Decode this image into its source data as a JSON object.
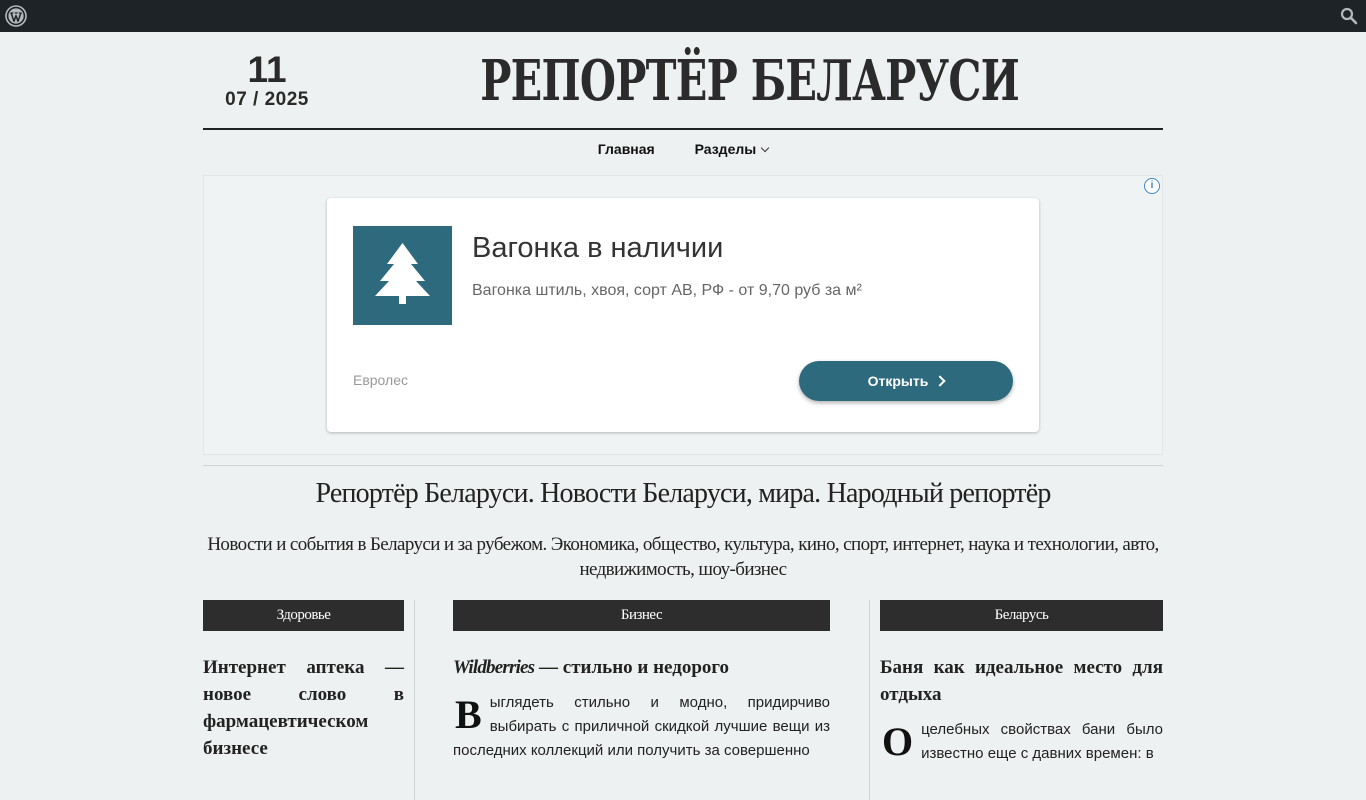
{
  "adminbar": {
    "logo_icon": "wordpress-icon",
    "search_icon": "search-icon"
  },
  "header": {
    "date_day": "11",
    "date_month_year": "07 / 2025",
    "site_title": "РЕПОРТЁР БЕЛАРУСИ"
  },
  "nav": {
    "items": [
      {
        "label": "Главная"
      },
      {
        "label": "Разделы",
        "icon": "chevron-down-icon"
      }
    ]
  },
  "ad": {
    "info_icon": "info-icon",
    "logo_icon": "tree-icon",
    "title": "Вагонка в наличии",
    "description": "Вагонка штиль, хвоя, сорт АВ, РФ - от 9,70 руб за м²",
    "brand": "Евролес",
    "button_label": "Открыть",
    "accent_color": "#2e6a7e"
  },
  "site": {
    "tagline": "Репортёр Беларуси. Новости Беларуси, мира. Народный репортёр",
    "description": "Новости и события в Беларуси и за рубежом. Экономика, общество, культура, кино, спорт, интернет, наука и технологии, авто, недвижимость, шоу-бизнес"
  },
  "columns": [
    {
      "heading": "Здоровье",
      "article_title": "Интернет аптека — новое слово в фармацевтическом бизнесе"
    },
    {
      "heading": "Бизнес",
      "article_title_em": "Wildberries",
      "article_title_rest": " — стильно и недорого",
      "dropcap": "В",
      "excerpt": "ыглядеть стильно и модно, придирчиво выбирать с приличной скидкой лучшие вещи из последних коллекций или получить за совершенно"
    },
    {
      "heading": "Беларусь",
      "article_title": "Баня как идеальное место для отдыха",
      "dropcap": "О",
      "excerpt": "целебных свойствах бани было известно еще с давних времен: в"
    }
  ]
}
